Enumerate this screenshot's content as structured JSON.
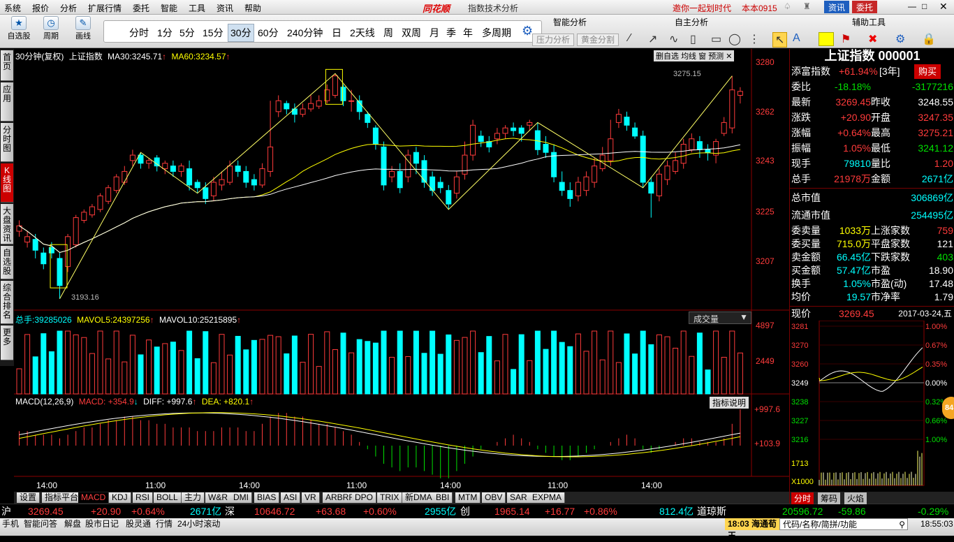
{
  "menu": {
    "items": [
      "系统",
      "报价",
      "分析",
      "扩展行情",
      "委托",
      "智能",
      "工具",
      "资讯",
      "帮助"
    ],
    "brand": "同花顺",
    "window_title": "指数技术分析",
    "invite": "邀你一起划时代",
    "version": "本本0915",
    "btn_news": "资讯",
    "btn_trade": "委托"
  },
  "toolbar": {
    "tool_self": "自选股",
    "tool_period": "周期",
    "tool_draw": "画线",
    "periods": [
      "分时",
      "1分",
      "5分",
      "15分",
      "30分",
      "60分",
      "240分钟",
      "日",
      "2天线",
      "周",
      "双周",
      "月",
      "季",
      "年",
      "多周期"
    ],
    "active_period": "30分",
    "smart_title": "智能分析",
    "self_title": "自主分析",
    "aux_title": "辅助工具",
    "btn_pressure": "压力分析",
    "btn_golden": "黄金分割"
  },
  "lefttabs": [
    "首页",
    "应用",
    "分时图",
    "K线图",
    "大盘资讯",
    "自选股",
    "综合排名",
    "更多"
  ],
  "chart": {
    "legend": {
      "period": "30分钟(复权)",
      "name": "上证指数",
      "ma30_label": "MA30:",
      "ma30": "3245.71",
      "ma60_label": "MA60:",
      "ma60": "3234.57"
    },
    "toplinks": [
      "删自选",
      "均线",
      "窗",
      "预测"
    ],
    "price_axis": [
      "3280",
      "3262",
      "3243",
      "3225",
      "3207"
    ],
    "high_label": "3275.15",
    "low_label": "3193.16",
    "time_axis": [
      "14:00",
      "11:00",
      "14:00",
      "11:00",
      "14:00",
      "11:00",
      "14:00"
    ],
    "vol": {
      "label_total": "总手:",
      "total": "39285026",
      "mavol5_label": "MAVOL5:",
      "mavol5": "24397256",
      "mavol10_label": "MAVOL10:",
      "mavol10": "25215895",
      "dropdown": "成交量",
      "axis": [
        "4897",
        "2449"
      ]
    },
    "macd": {
      "label": "MACD(12,26,9)",
      "macd": "MACD: +354.9",
      "diff": "DIFF: +997.6",
      "dea": "DEA: +820.1",
      "help": "指标说明",
      "axis": [
        "+997.6",
        "+103.9"
      ]
    }
  },
  "chart_data": {
    "type": "candlestick",
    "title": "上证指数",
    "period": "30分钟",
    "ylim": [
      3190,
      3282
    ],
    "candles": [
      [
        3218,
        3220,
        3216,
        3222
      ],
      [
        3214,
        3216,
        3212,
        3218
      ],
      [
        3215,
        3211,
        3208,
        3217
      ],
      [
        3210,
        3206,
        3204,
        3212
      ],
      [
        3212,
        3210,
        3208,
        3214
      ],
      [
        3208,
        3198,
        3193.16,
        3210
      ],
      [
        3205,
        3216,
        3203,
        3217
      ],
      [
        3213,
        3223,
        3212,
        3224
      ],
      [
        3222,
        3225,
        3221,
        3226
      ],
      [
        3224,
        3227,
        3223,
        3228
      ],
      [
        3226,
        3231,
        3225,
        3232
      ],
      [
        3229,
        3234,
        3228,
        3235
      ],
      [
        3233,
        3238,
        3232,
        3239
      ],
      [
        3236,
        3240,
        3235,
        3242
      ],
      [
        3244,
        3246,
        3242,
        3248
      ],
      [
        3246,
        3243,
        3241,
        3247
      ],
      [
        3243,
        3244,
        3241,
        3245
      ],
      [
        3245,
        3242,
        3240,
        3246
      ],
      [
        3241,
        3243,
        3239,
        3244
      ],
      [
        3242,
        3240,
        3238,
        3244
      ],
      [
        3240,
        3242,
        3238,
        3243
      ],
      [
        3241,
        3235,
        3233,
        3244
      ],
      [
        3236,
        3234,
        3232,
        3237
      ],
      [
        3234,
        3230,
        3228,
        3236
      ],
      [
        3231,
        3236,
        3229,
        3238
      ],
      [
        3235,
        3237,
        3233,
        3240
      ],
      [
        3236,
        3242,
        3235,
        3244
      ],
      [
        3242,
        3240,
        3238,
        3244
      ],
      [
        3240,
        3236,
        3234,
        3242
      ],
      [
        3237,
        3235,
        3233,
        3239
      ],
      [
        3235,
        3241,
        3234,
        3243
      ],
      [
        3240,
        3249,
        3238,
        3266
      ],
      [
        3262,
        3266,
        3260,
        3268
      ],
      [
        3265,
        3263,
        3261,
        3266
      ],
      [
        3263,
        3261,
        3258,
        3265
      ],
      [
        3261,
        3263,
        3260,
        3265
      ],
      [
        3263,
        3265,
        3262,
        3268
      ],
      [
        3264,
        3266,
        3263,
        3268
      ],
      [
        3266,
        3270,
        3265,
        3272
      ],
      [
        3268,
        3275.15,
        3267,
        3276
      ],
      [
        3271,
        3266,
        3264,
        3272
      ],
      [
        3266,
        3266,
        3262,
        3270
      ],
      [
        3266,
        3262,
        3259,
        3268
      ],
      [
        3261,
        3258,
        3256,
        3262
      ],
      [
        3256,
        3250,
        3248,
        3257
      ],
      [
        3249,
        3235,
        3233,
        3251
      ],
      [
        3238,
        3240,
        3236,
        3242
      ],
      [
        3240,
        3234,
        3232,
        3243
      ],
      [
        3238,
        3246,
        3236,
        3248
      ],
      [
        3247,
        3243,
        3239,
        3249
      ],
      [
        3244,
        3236,
        3234,
        3246
      ],
      [
        3238,
        3233,
        3231,
        3240
      ],
      [
        3236,
        3234,
        3232,
        3238
      ],
      [
        3233,
        3228,
        3226,
        3235
      ],
      [
        3232,
        3238,
        3230,
        3240
      ],
      [
        3239,
        3246,
        3237,
        3251
      ],
      [
        3246,
        3257,
        3244,
        3259
      ],
      [
        3253,
        3251,
        3249,
        3255
      ],
      [
        3251,
        3249,
        3247,
        3253
      ],
      [
        3252,
        3254,
        3250,
        3256
      ],
      [
        3254,
        3256,
        3252,
        3257
      ],
      [
        3256,
        3255,
        3253,
        3258
      ],
      [
        3256,
        3254,
        3251,
        3257
      ],
      [
        3257,
        3258,
        3255,
        3259
      ],
      [
        3255,
        3248,
        3246,
        3258
      ],
      [
        3250,
        3247,
        3245,
        3253
      ],
      [
        3247,
        3238,
        3236,
        3250
      ],
      [
        3236,
        3233,
        3231,
        3240
      ],
      [
        3233,
        3230,
        3227,
        3236
      ],
      [
        3231,
        3236,
        3229,
        3238
      ],
      [
        3233,
        3238,
        3231,
        3240
      ],
      [
        3236,
        3242,
        3234,
        3245
      ],
      [
        3241,
        3246,
        3240,
        3249
      ],
      [
        3244,
        3252,
        3242,
        3259
      ],
      [
        3258,
        3261,
        3256,
        3263
      ],
      [
        3260,
        3257,
        3255,
        3262
      ],
      [
        3256,
        3253,
        3252,
        3258
      ],
      [
        3253,
        3236,
        3234,
        3255
      ],
      [
        3236,
        3232,
        3223,
        3238
      ],
      [
        3231,
        3239,
        3229,
        3241
      ],
      [
        3237,
        3242,
        3235,
        3244
      ],
      [
        3240,
        3244,
        3239,
        3247
      ],
      [
        3243,
        3250,
        3241,
        3252
      ],
      [
        3248,
        3252,
        3247,
        3254
      ],
      [
        3251,
        3248,
        3245,
        3253
      ],
      [
        3248,
        3247,
        3244,
        3250
      ],
      [
        3246,
        3251,
        3243,
        3252
      ],
      [
        3254,
        3258,
        3253,
        3260
      ],
      [
        3256,
        3270,
        3254,
        3275.15
      ],
      [
        3268,
        3269.45,
        3265,
        3271
      ]
    ],
    "macd_values": [
      0.4,
      0.4,
      0.3,
      0.3,
      0.3,
      0.2,
      0.3,
      0.4,
      0.5,
      0.5,
      0.6,
      0.7,
      0.7,
      0.8,
      0.8,
      0.7,
      0.7,
      0.6,
      0.6,
      0.5,
      0.5,
      0.5,
      0.4,
      0.4,
      0.4,
      0.5,
      0.5,
      0.5,
      0.4,
      0.4,
      0.6,
      0.8,
      0.9,
      0.9,
      0.8,
      0.8,
      0.7,
      0.6,
      0.6,
      0.5,
      0.4,
      0.3,
      0.1,
      -0.1,
      -0.3,
      -0.5,
      -0.6,
      -0.7,
      -0.6,
      -0.6,
      -0.7,
      -0.8,
      -0.9,
      -0.9,
      -0.7,
      -0.5,
      -0.3,
      -0.1,
      0.0,
      0.1,
      0.2,
      0.3,
      0.2,
      0.1,
      -0.1,
      -0.2,
      -0.3,
      -0.4,
      -0.4,
      -0.3,
      -0.2,
      -0.1,
      0.0,
      0.1,
      0.2,
      0.3,
      0.2,
      -0.1,
      -0.2,
      -0.1,
      0.0,
      0.1,
      0.2,
      0.2,
      0.1,
      0.1,
      0.1,
      0.2,
      0.6,
      1.0
    ]
  },
  "bottom_tabs": [
    "设置",
    "指标平台",
    "MACD",
    "KDJ",
    "RSI",
    "BOLL",
    "主力",
    "W&R",
    "DMI",
    "BIAS",
    "ASI",
    "VR",
    "ARBRR",
    "DPO",
    "TRIX",
    "新DMA",
    "BBI",
    "MTM",
    "OBV",
    "SAR",
    "EXPMA"
  ],
  "active_tab": "MACD",
  "ticker": {
    "sh_label": "沪",
    "sh_price": "3269.45",
    "sh_change": "+20.90",
    "sh_pct": "+0.64%",
    "sh_amount": "2671亿",
    "sz_label": "深",
    "sz_price": "10646.72",
    "sz_change": "+63.68",
    "sz_pct": "+0.60%",
    "sz_amount": "2955亿",
    "cy_label": "创",
    "cy_price": "1965.14",
    "cy_change": "+16.77",
    "cy_pct": "+0.86%",
    "cy_amount": "812.4亿",
    "dj_label": "道琼斯",
    "dj_price": "20596.72",
    "dj_change": "-59.86",
    "dj_pct": "-0.29%"
  },
  "status": {
    "items": [
      "手机",
      "智能问答",
      "解盘",
      "股市日记",
      "股灵通",
      "行情",
      "24小时滚动"
    ],
    "news_time": "18:03",
    "news": "海通荀玉",
    "search": "代码/名称/简拼/功能",
    "clock": "18:55:03"
  },
  "panel": {
    "title": "上证指数 000001",
    "tfz_label": "添富指数",
    "tfz_val": "+61.94%",
    "tfz_period": "[3年]",
    "buy": "购买",
    "rows": [
      {
        "l": "委比",
        "v": "-18.18%",
        "r": "-3177216"
      },
      {
        "l": "最新",
        "v": "3269.45",
        "l2": "昨收",
        "v2": "3248.55"
      },
      {
        "l": "涨跌",
        "v": "+20.90",
        "l2": "开盘",
        "v2": "3247.35"
      },
      {
        "l": "涨幅",
        "v": "+0.64%",
        "l2": "最高",
        "v2": "3275.21"
      },
      {
        "l": "振幅",
        "v": "1.05%",
        "l2": "最低",
        "v2": "3241.12"
      },
      {
        "l": "现手",
        "v": "79810",
        "l2": "量比",
        "v2": "1.20"
      },
      {
        "l": "总手",
        "v": "21978万",
        "l2": "金额",
        "v2": "2671亿"
      }
    ],
    "mkt_cap_label": "总市值",
    "mkt_cap": "306869亿",
    "float_cap_label": "流通市值",
    "float_cap": "254495亿",
    "rows2": [
      {
        "l": "委卖量",
        "v": "1033万",
        "l2": "上涨家数",
        "v2": "759"
      },
      {
        "l": "委买量",
        "v": "715.0万",
        "l2": "平盘家数",
        "v2": "121"
      },
      {
        "l": "卖金额",
        "v": "66.45亿",
        "l2": "下跌家数",
        "v2": "403"
      },
      {
        "l": "买金额",
        "v": "57.47亿",
        "l2": "市盈",
        "v2": "18.90"
      },
      {
        "l": "换手",
        "v": "1.05%",
        "l2": "市盈(动)",
        "v2": "17.48"
      },
      {
        "l": "均价",
        "v": "19.57",
        "l2": "市净率",
        "v2": "1.79"
      }
    ],
    "mini_label": "现价",
    "mini_price": "3269.45",
    "mini_date": "2017-03-24,五",
    "mini_left": [
      "3281",
      "3270",
      "3260",
      "3249",
      "3238",
      "3227",
      "3216",
      "1713",
      "X1000"
    ],
    "mini_right": [
      "1.00%",
      "0.67%",
      "0.35%",
      "0.00%",
      "0.32%",
      "0.66%",
      "1.00%"
    ],
    "mini_tabs": [
      "分时",
      "筹码",
      "火焰"
    ],
    "badge": "84"
  }
}
